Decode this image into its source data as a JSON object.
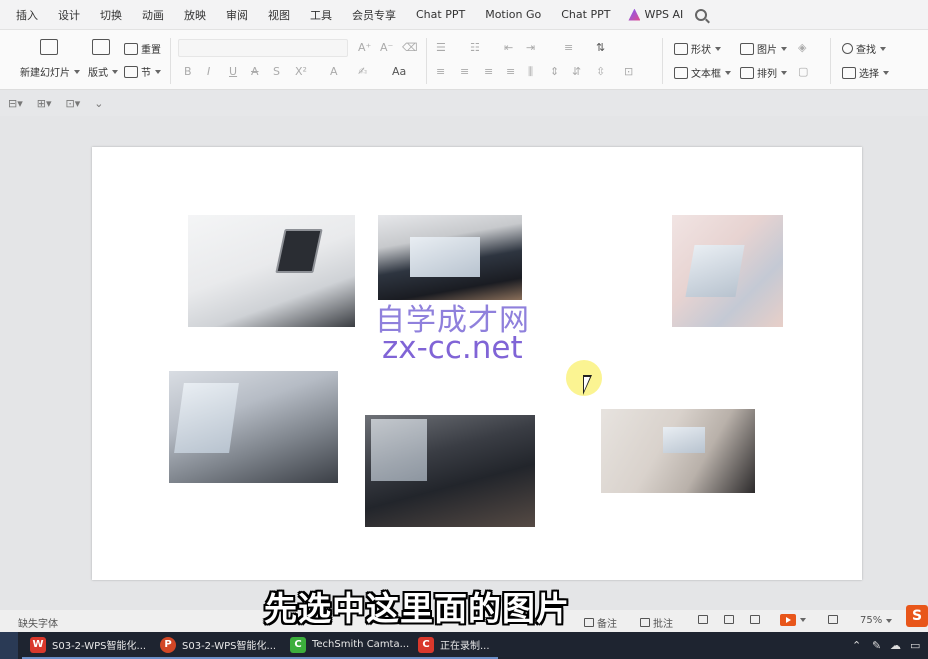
{
  "menu": {
    "items": [
      "插入",
      "设计",
      "切换",
      "动画",
      "放映",
      "审阅",
      "视图",
      "工具",
      "会员专享",
      "Chat PPT",
      "Motion Go",
      "Chat PPT"
    ],
    "ai_label": "WPS AI"
  },
  "ribbon": {
    "new_slide": "新建幻灯片",
    "layout": "版式",
    "reset": "重置",
    "section": "节",
    "shape": "形状",
    "picture": "图片",
    "textbox": "文本框",
    "arrange": "排列",
    "find": "查找",
    "select": "选择",
    "font_btn_bold": "B",
    "font_btn_italic": "I",
    "font_btn_underline": "U",
    "font_btn_strike": "A",
    "font_btn_s": "S",
    "font_btn_super": "X²",
    "font_color": "A",
    "highlight": "✍",
    "char_space": "Aa"
  },
  "subtoolbar": {
    "icons": [
      "align-icon",
      "group-icon",
      "crop-icon",
      "more-icon"
    ]
  },
  "slide": {
    "watermark_cn": "自学成才网",
    "watermark_url": "zx-cc.net"
  },
  "statusbar": {
    "missing_font": "缺失字体",
    "notes": "备注",
    "comments": "批注",
    "zoom": "75%",
    "logo": "S"
  },
  "subtitle": "先选中这里面的图片",
  "taskbar": {
    "items": [
      {
        "label": "S03-2-WPS智能化...",
        "icon": "W",
        "color": "#d9382c"
      },
      {
        "label": "S03-2-WPS智能化...",
        "icon": "P",
        "color": "#d24726"
      },
      {
        "label": "TechSmith Camta...",
        "icon": "C",
        "color": "#3cae3c"
      },
      {
        "label": "正在录制...",
        "icon": "C",
        "color": "#d9382c"
      }
    ]
  }
}
